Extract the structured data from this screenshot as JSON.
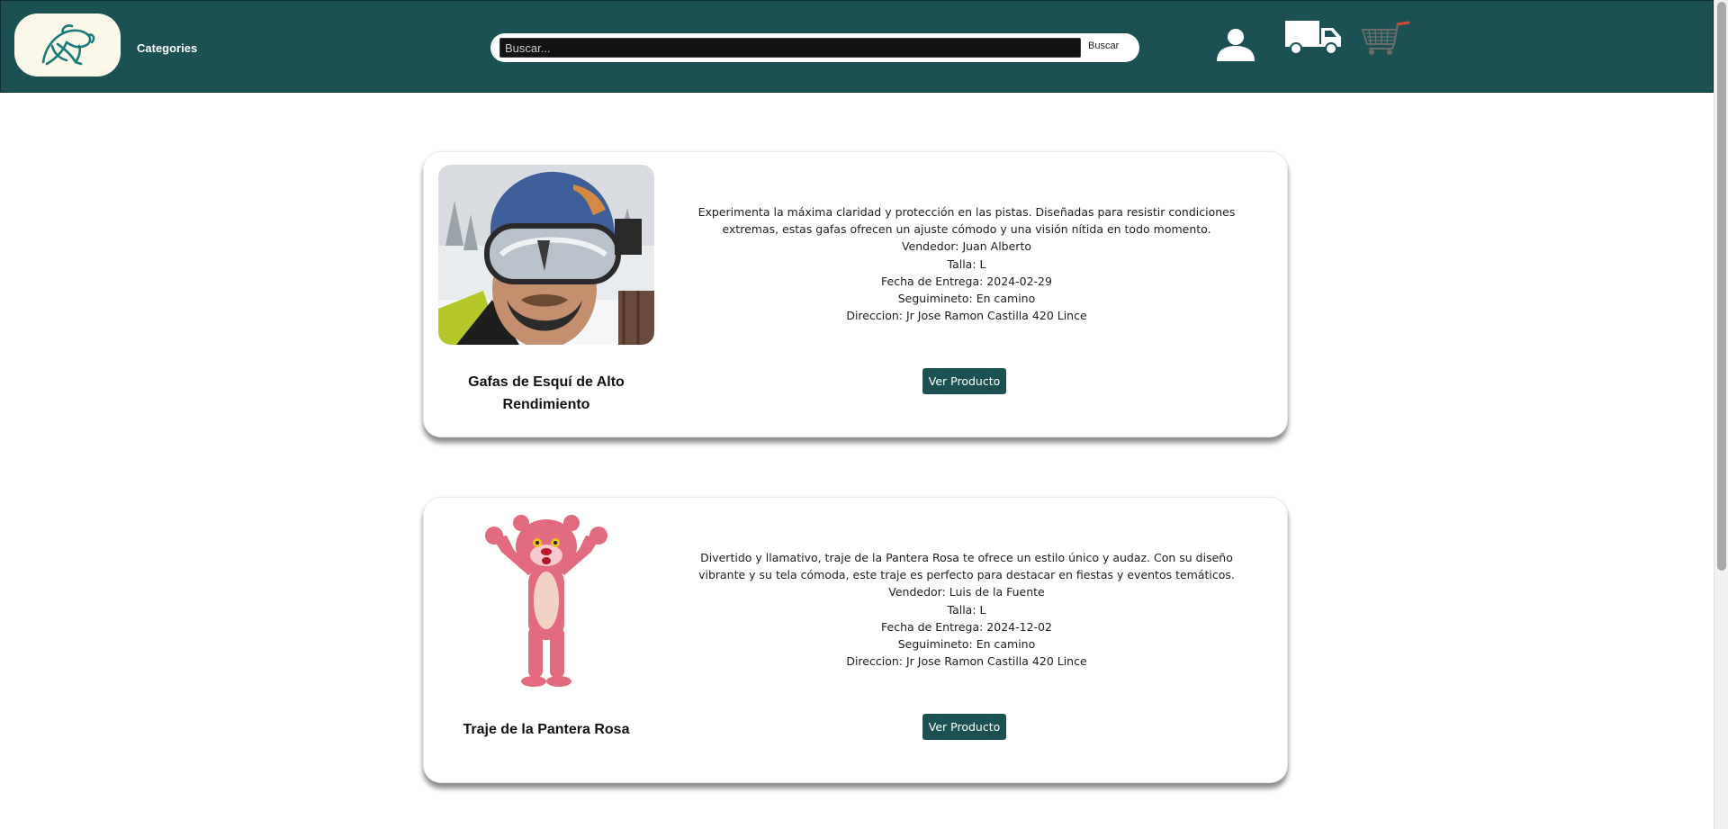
{
  "header": {
    "categories_label": "Categories",
    "search": {
      "placeholder": "Buscar...",
      "value": "",
      "button_label": "Buscar"
    },
    "icons": [
      "logo-icon",
      "user-icon",
      "truck-icon",
      "cart-icon"
    ],
    "colors": {
      "header_bg": "#1b5153",
      "logo_bg": "#fbf8ea",
      "button_bg": "#1b5153"
    }
  },
  "products": [
    {
      "title": "Gafas de Esquí de Alto Rendimiento",
      "description": "Experimenta la máxima claridad y protección en las pistas. Diseñadas para resistir condiciones extremas, estas gafas ofrecen un ajuste cómodo y una visión nítida en todo momento.",
      "seller": "Vendedor: Juan Alberto",
      "size": "Talla: L",
      "delivery": "Fecha de Entrega: 2024-02-29",
      "tracking": "Seguimineto: En camino",
      "address": "Direccion: Jr Jose Ramon Castilla 420 Lince",
      "button_label": "Ver Producto"
    },
    {
      "title": "Traje de la Pantera Rosa",
      "description": "Divertido y llamativo, traje de la Pantera Rosa te ofrece un estilo único y audaz. Con su diseño vibrante y su tela cómoda, este traje es perfecto para destacar en fiestas y eventos temáticos.",
      "seller": "Vendedor: Luis de la Fuente",
      "size": "Talla: L",
      "delivery": "Fecha de Entrega: 2024-12-02",
      "tracking": "Seguimineto: En camino",
      "address": "Direccion: Jr Jose Ramon Castilla 420 Lince",
      "button_label": "Ver Producto"
    }
  ]
}
